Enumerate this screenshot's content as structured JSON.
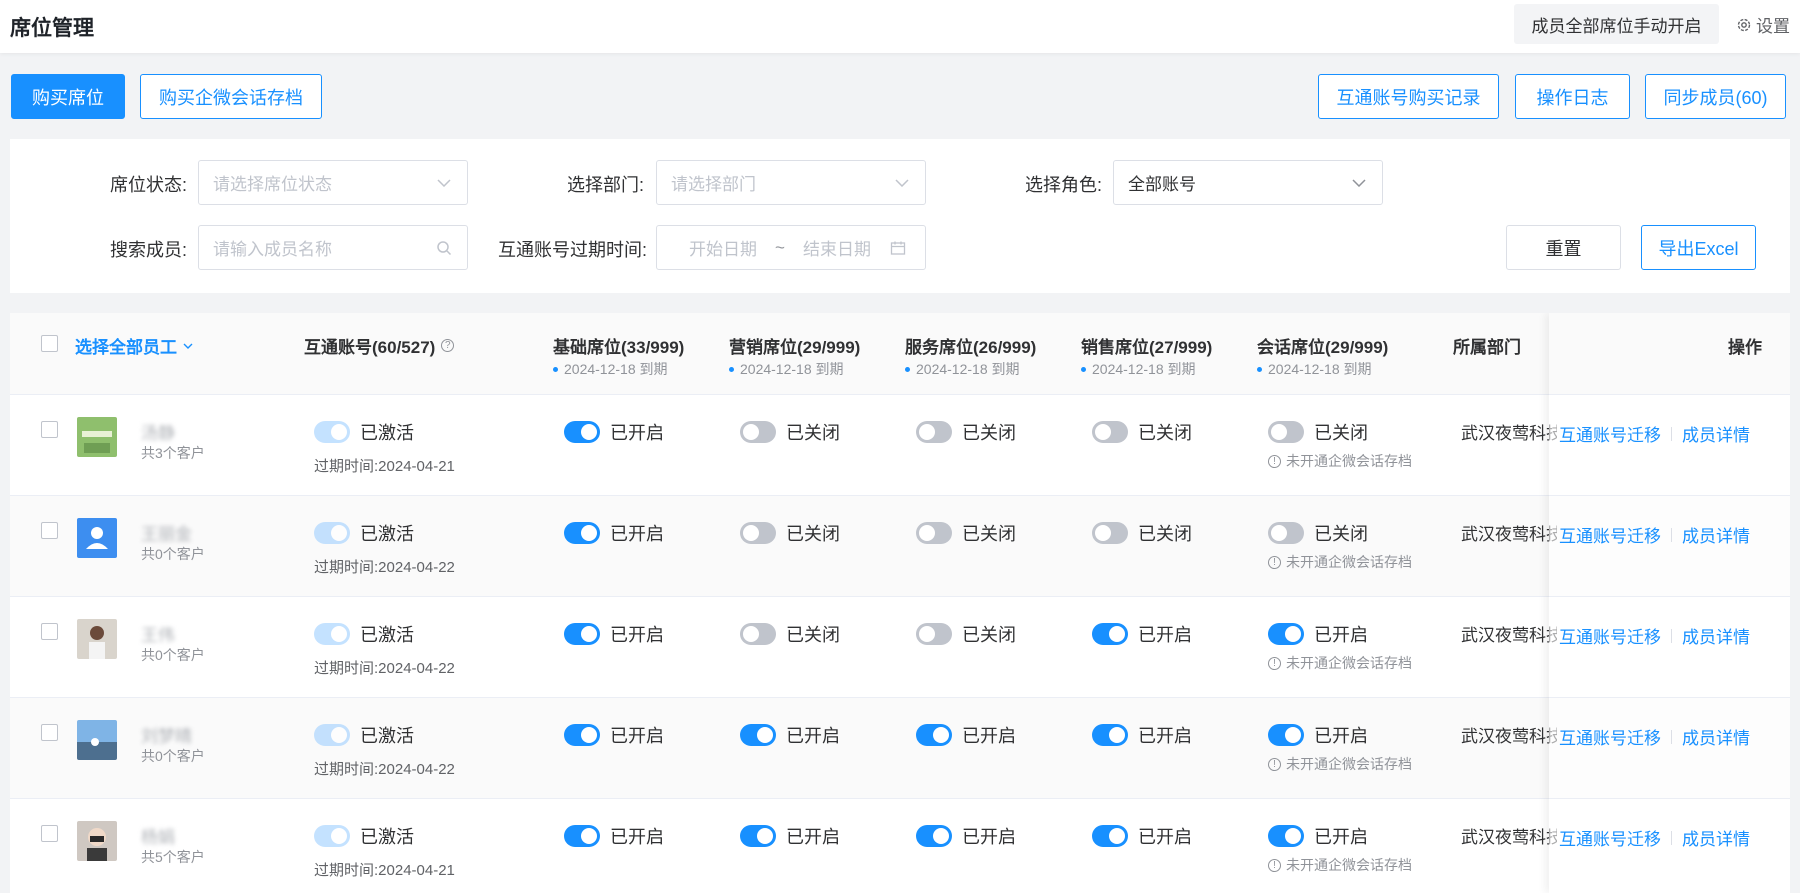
{
  "header": {
    "title": "席位管理",
    "manual_open": "成员全部席位手动开启",
    "settings": "设置"
  },
  "actions": {
    "buy_seat": "购买席位",
    "buy_archive": "购买企微会话存档",
    "purchase_records": "互通账号购买记录",
    "op_log": "操作日志",
    "sync_members": "同步成员(60)"
  },
  "filters": {
    "seat_status_label": "席位状态:",
    "seat_status_placeholder": "请选择席位状态",
    "dept_label": "选择部门:",
    "dept_placeholder": "请选择部门",
    "role_label": "选择角色:",
    "role_value": "全部账号",
    "search_label": "搜索成员:",
    "search_placeholder": "请输入成员名称",
    "expire_label": "互通账号过期时间:",
    "start_date": "开始日期",
    "date_sep": "~",
    "end_date": "结束日期",
    "reset": "重置",
    "export": "导出Excel"
  },
  "table": {
    "select_all": "选择全部员工",
    "col_account": "互通账号(60/527)",
    "col_basic": "基础席位(33/999)",
    "col_marketing": "营销席位(29/999)",
    "col_service": "服务席位(26/999)",
    "col_sales": "销售席位(27/999)",
    "col_session": "会话席位(29/999)",
    "col_dept": "所属部门",
    "col_ops": "操作",
    "expire_hint": "2024-12-18 到期",
    "rows": [
      {
        "name": "汤静",
        "customers": "共3个客户",
        "account": "已激活",
        "expire": "过期时间:2024-04-21",
        "basic": "已开启",
        "marketing": "已关闭",
        "service": "已关闭",
        "sales": "已关闭",
        "session": "已关闭",
        "note": "未开通企微会话存档",
        "dept": "武汉夜莺科技有限公司",
        "op1": "互通账号迁移",
        "op2": "成员详情"
      },
      {
        "name": "王丽金",
        "customers": "共0个客户",
        "account": "已激活",
        "expire": "过期时间:2024-04-22",
        "basic": "已开启",
        "marketing": "已关闭",
        "service": "已关闭",
        "sales": "已关闭",
        "session": "已关闭",
        "note": "未开通企微会话存档",
        "dept": "武汉夜莺科技有限公司",
        "op1": "互通账号迁移",
        "op2": "成员详情"
      },
      {
        "name": "王伟",
        "customers": "共0个客户",
        "account": "已激活",
        "expire": "过期时间:2024-04-22",
        "basic": "已开启",
        "marketing": "已关闭",
        "service": "已关闭",
        "sales": "已开启",
        "session": "已开启",
        "note": "未开通企微会话存档",
        "dept": "武汉夜莺科技有限公司",
        "op1": "互通账号迁移",
        "op2": "成员详情"
      },
      {
        "name": "刘梦晴",
        "customers": "共0个客户",
        "account": "已激活",
        "expire": "过期时间:2024-04-22",
        "basic": "已开启",
        "marketing": "已开启",
        "service": "已开启",
        "sales": "已开启",
        "session": "已开启",
        "note": "未开通企微会话存档",
        "dept": "武汉夜莺科技有限公司",
        "op1": "互通账号迁移",
        "op2": "成员详情"
      },
      {
        "name": "杨娟",
        "customers": "共5个客户",
        "account": "已激活",
        "expire": "过期时间:2024-04-21",
        "basic": "已开启",
        "marketing": "已开启",
        "service": "已开启",
        "sales": "已开启",
        "session": "已开启",
        "note": "未开通企微会话存档",
        "dept": "武汉夜莺科技有限公司",
        "op1": "互通账号迁移",
        "op2": "成员详情"
      }
    ]
  }
}
